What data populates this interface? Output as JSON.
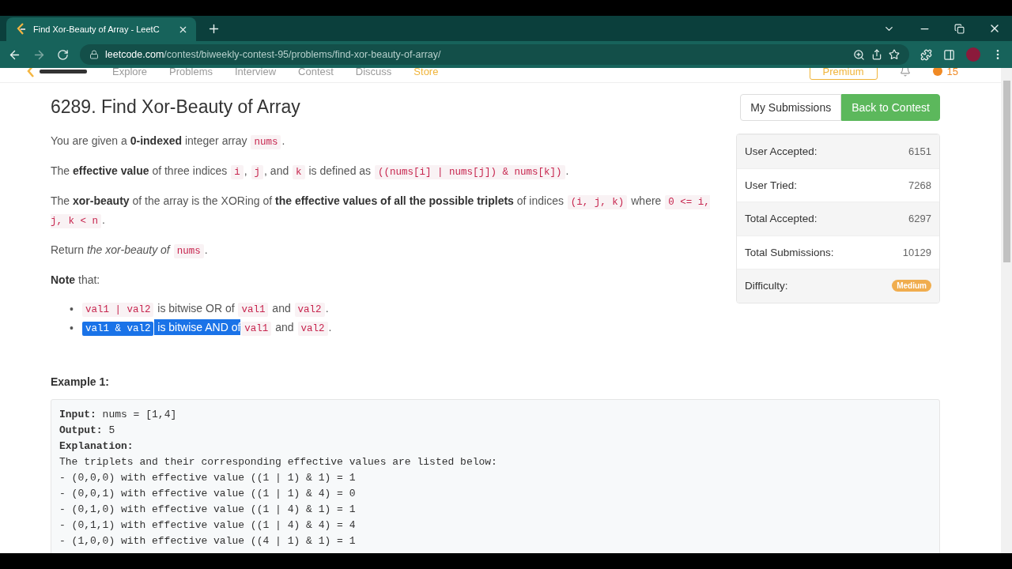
{
  "browser": {
    "tab_title": "Find Xor-Beauty of Array - LeetC",
    "url_host": "leetcode.com",
    "url_path": "/contest/biweekly-contest-95/problems/find-xor-beauty-of-array/"
  },
  "site_nav": {
    "items": [
      "Explore",
      "Problems",
      "Interview",
      "Contest",
      "Discuss"
    ],
    "store": "Store",
    "premium": "Premium",
    "coins": "15"
  },
  "problem": {
    "title": "6289. Find Xor-Beauty of Array",
    "paragraphs": [
      [
        {
          "kind": "text",
          "text": "You are given a **0-indexed** integer array "
        },
        {
          "kind": "code",
          "text": "nums"
        },
        {
          "kind": "text",
          "text": "."
        }
      ],
      [
        {
          "kind": "text",
          "text": "The **effective value** of three indices "
        },
        {
          "kind": "code",
          "text": "i"
        },
        {
          "kind": "text",
          "text": ", "
        },
        {
          "kind": "code",
          "text": "j"
        },
        {
          "kind": "text",
          "text": ", and "
        },
        {
          "kind": "code",
          "text": "k"
        },
        {
          "kind": "text",
          "text": " is defined as "
        },
        {
          "kind": "code",
          "text": "((nums[i] | nums[j]) & nums[k])"
        },
        {
          "kind": "text",
          "text": "."
        }
      ],
      [
        {
          "kind": "text",
          "text": "The **xor-beauty** of the array is the XORing of **the effective values of all the possible triplets** of indices "
        },
        {
          "kind": "code",
          "text": "(i, j, k)"
        },
        {
          "kind": "text",
          "text": " where "
        },
        {
          "kind": "code",
          "text": "0 <= i, j, k < n"
        },
        {
          "kind": "text",
          "text": "."
        }
      ],
      [
        {
          "kind": "text",
          "text": "Return *the xor-beauty of* "
        },
        {
          "kind": "code",
          "text": "nums"
        },
        {
          "kind": "text",
          "text": "."
        }
      ],
      [
        {
          "kind": "text",
          "text": "**Note** that:"
        }
      ]
    ],
    "bullets": [
      {
        "marker": "•",
        "segments": [
          {
            "kind": "code",
            "text": "val1 | val2",
            "selected": false
          },
          {
            "kind": "text",
            "text": " is bitwise OR of ",
            "selected": false
          },
          {
            "kind": "code",
            "text": "val1",
            "selected": false
          },
          {
            "kind": "text",
            "text": " and ",
            "selected": false
          },
          {
            "kind": "code",
            "text": "val2",
            "selected": false
          },
          {
            "kind": "text",
            "text": ".",
            "selected": false
          }
        ]
      },
      {
        "marker": "•",
        "segments": [
          {
            "kind": "code",
            "text": "val1 & val2",
            "selected": true
          },
          {
            "kind": "text",
            "text": " is bitwise AND of",
            "selected": true
          },
          {
            "kind": "code",
            "text": "val1",
            "selected": false
          },
          {
            "kind": "text",
            "text": " and ",
            "selected": false
          },
          {
            "kind": "code",
            "text": "val2",
            "selected": false
          },
          {
            "kind": "text",
            "text": ".",
            "selected": false
          }
        ]
      }
    ],
    "example_title": "Example 1:",
    "example_lines": [
      {
        "label": "Input:",
        "text": " nums = [1,4]"
      },
      {
        "label": "Output:",
        "text": " 5"
      },
      {
        "label": "Explanation:"
      },
      {
        "text": "The triplets and their corresponding effective values are listed below:"
      },
      {
        "text": "- (0,0,0) with effective value ((1 | 1) & 1) = 1"
      },
      {
        "text": "- (0,0,1) with effective value ((1 | 1) & 4) = 0"
      },
      {
        "text": "- (0,1,0) with effective value ((1 | 4) & 1) = 1"
      },
      {
        "text": "- (0,1,1) with effective value ((1 | 4) & 4) = 4"
      },
      {
        "text": "- (1,0,0) with effective value ((4 | 1) & 1) = 1"
      }
    ]
  },
  "actions": [
    {
      "label": "My Submissions",
      "kind": "outline"
    },
    {
      "label": "Back to Contest",
      "kind": "primary"
    }
  ],
  "stats": [
    {
      "label": "User Accepted:",
      "value": "6151"
    },
    {
      "label": "User Tried:",
      "value": "7268"
    },
    {
      "label": "Total Accepted:",
      "value": "6297"
    },
    {
      "label": "Total Submissions:",
      "value": "10129"
    },
    {
      "label": "Difficulty:",
      "badge": "Medium"
    }
  ]
}
